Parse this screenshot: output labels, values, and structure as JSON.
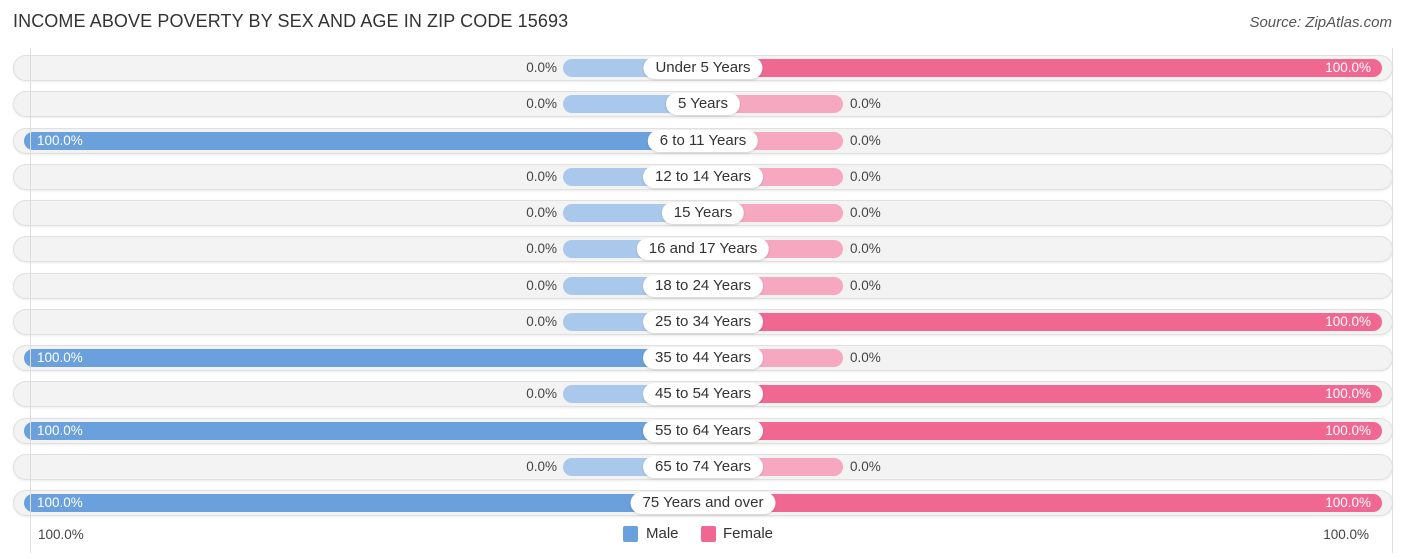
{
  "title": "INCOME ABOVE POVERTY BY SEX AND AGE IN ZIP CODE 15693",
  "source": "Source: ZipAtlas.com",
  "colors": {
    "male": "#6aa0dc",
    "male_light": "#aac8eb",
    "female": "#f06892",
    "female_light": "#f6a8c1"
  },
  "chart_data": {
    "type": "bar",
    "orientation": "horizontal-diverging",
    "title": "INCOME ABOVE POVERTY BY SEX AND AGE IN ZIP CODE 15693",
    "categories": [
      "Under 5 Years",
      "5 Years",
      "6 to 11 Years",
      "12 to 14 Years",
      "15 Years",
      "16 and 17 Years",
      "18 to 24 Years",
      "25 to 34 Years",
      "35 to 44 Years",
      "45 to 54 Years",
      "55 to 64 Years",
      "65 to 74 Years",
      "75 Years and over"
    ],
    "series": [
      {
        "name": "Male",
        "values": [
          0,
          0,
          100,
          0,
          0,
          0,
          0,
          0,
          100,
          0,
          100,
          0,
          100
        ]
      },
      {
        "name": "Female",
        "values": [
          100,
          0,
          0,
          0,
          0,
          0,
          0,
          100,
          0,
          100,
          100,
          0,
          100
        ]
      }
    ],
    "labels": {
      "Male": [
        "0.0%",
        "0.0%",
        "100.0%",
        "0.0%",
        "0.0%",
        "0.0%",
        "0.0%",
        "0.0%",
        "100.0%",
        "0.0%",
        "100.0%",
        "0.0%",
        "100.0%"
      ],
      "Female": [
        "100.0%",
        "0.0%",
        "0.0%",
        "0.0%",
        "0.0%",
        "0.0%",
        "0.0%",
        "100.0%",
        "0.0%",
        "100.0%",
        "100.0%",
        "0.0%",
        "100.0%"
      ]
    },
    "xlim": [
      0,
      100
    ],
    "axis_labels": {
      "left": "100.0%",
      "right": "100.0%"
    },
    "legend": {
      "entries": [
        "Male",
        "Female"
      ],
      "placement": "bottom-center"
    },
    "grid": false
  }
}
